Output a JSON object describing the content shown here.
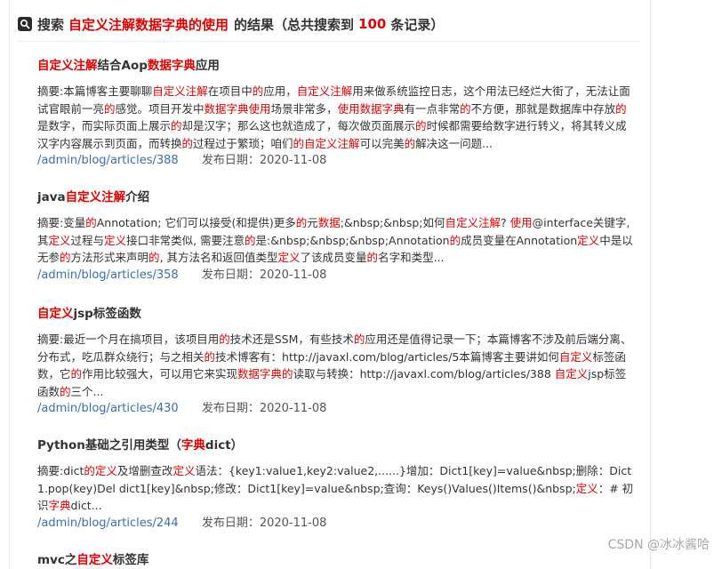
{
  "header": {
    "prefix": "搜索",
    "keyword": "自定义注解数据字典的使用",
    "middle": "的结果（总共搜索到",
    "count": "100",
    "suffix": "条记录）"
  },
  "results": [
    {
      "title": [
        {
          "t": "自定义注解",
          "h": true
        },
        {
          "t": "结合Aop",
          "h": false
        },
        {
          "t": "数据字典",
          "h": true
        },
        {
          "t": "应用",
          "h": false
        }
      ],
      "summary": [
        {
          "t": "摘要:本篇博客主要聊聊",
          "h": false
        },
        {
          "t": "自定义注解",
          "h": true
        },
        {
          "t": "在项目中",
          "h": false
        },
        {
          "t": "的",
          "h": true
        },
        {
          "t": "应用，",
          "h": false
        },
        {
          "t": "自定义注解",
          "h": true
        },
        {
          "t": "用来做系统监控日志，这个用法已经烂大街了，无法让面试官眼前一亮",
          "h": false
        },
        {
          "t": "的",
          "h": true
        },
        {
          "t": "感觉。项目开发中",
          "h": false
        },
        {
          "t": "数据字典使用",
          "h": true
        },
        {
          "t": "场景非常多，",
          "h": false
        },
        {
          "t": "使用数据字典",
          "h": true
        },
        {
          "t": "有一点非常",
          "h": false
        },
        {
          "t": "的",
          "h": true
        },
        {
          "t": "不方便，那就是数据库中存放",
          "h": false
        },
        {
          "t": "的",
          "h": true
        },
        {
          "t": "是数字，而实际页面上展示",
          "h": false
        },
        {
          "t": "的",
          "h": true
        },
        {
          "t": "却是汉字；那么这也就造成了，每次做页面展示",
          "h": false
        },
        {
          "t": "的",
          "h": true
        },
        {
          "t": "时候都需要给数字进行转义，将其转义成汉字内容展示到页面，而转换",
          "h": false
        },
        {
          "t": "的",
          "h": true
        },
        {
          "t": "过程过于繁琐；咱们",
          "h": false
        },
        {
          "t": "的自定义注解",
          "h": true
        },
        {
          "t": "可以完美",
          "h": false
        },
        {
          "t": "的",
          "h": true
        },
        {
          "t": "解决这一问题...",
          "h": false
        }
      ],
      "link": "/admin/blog/articles/388",
      "date": "发布日期：2020-11-08"
    },
    {
      "title": [
        {
          "t": "java",
          "h": false
        },
        {
          "t": "自定义注解",
          "h": true
        },
        {
          "t": "介绍",
          "h": false
        }
      ],
      "summary": [
        {
          "t": "摘要:变量",
          "h": false
        },
        {
          "t": "的",
          "h": true
        },
        {
          "t": "Annotation; 它们可以接受(和提供)更多",
          "h": false
        },
        {
          "t": "的",
          "h": true
        },
        {
          "t": "元",
          "h": false
        },
        {
          "t": "数据",
          "h": true
        },
        {
          "t": ";&nbsp;&nbsp;如何",
          "h": false
        },
        {
          "t": "自定义注解",
          "h": true
        },
        {
          "t": "? ",
          "h": false
        },
        {
          "t": "使用",
          "h": true
        },
        {
          "t": "@interface关键字, 其",
          "h": false
        },
        {
          "t": "定义",
          "h": true
        },
        {
          "t": "过程与",
          "h": false
        },
        {
          "t": "定义",
          "h": true
        },
        {
          "t": "接口非常类似, 需要注意",
          "h": false
        },
        {
          "t": "的",
          "h": true
        },
        {
          "t": "是:&nbsp;&nbsp;&nbsp;Annotation",
          "h": false
        },
        {
          "t": "的",
          "h": true
        },
        {
          "t": "成员变量在Annotation",
          "h": false
        },
        {
          "t": "定义",
          "h": true
        },
        {
          "t": "中是以无参",
          "h": false
        },
        {
          "t": "的",
          "h": true
        },
        {
          "t": "方法形式来声明",
          "h": false
        },
        {
          "t": "的",
          "h": true
        },
        {
          "t": ", 其方法名和返回值类型",
          "h": false
        },
        {
          "t": "定义",
          "h": true
        },
        {
          "t": "了该成员变量",
          "h": false
        },
        {
          "t": "的",
          "h": true
        },
        {
          "t": "名字和类型...",
          "h": false
        }
      ],
      "link": "/admin/blog/articles/358",
      "date": "发布日期：2020-11-08"
    },
    {
      "title": [
        {
          "t": "自定义",
          "h": true
        },
        {
          "t": "jsp标签函数",
          "h": false
        }
      ],
      "summary": [
        {
          "t": "摘要:最近一个月在搞项目，该项目用",
          "h": false
        },
        {
          "t": "的",
          "h": true
        },
        {
          "t": "技术还是SSM，有些技术",
          "h": false
        },
        {
          "t": "的",
          "h": true
        },
        {
          "t": "应用还是值得记录一下；本篇博客不涉及前后端分离、分布式，吃瓜群众绕行；与之相关",
          "h": false
        },
        {
          "t": "的",
          "h": true
        },
        {
          "t": "技术博客有：http://javaxl.com/blog/articles/5本篇博客主要讲如何",
          "h": false
        },
        {
          "t": "自定义",
          "h": true
        },
        {
          "t": "标签函数，它",
          "h": false
        },
        {
          "t": "的",
          "h": true
        },
        {
          "t": "作用比较强大，可以用它来实现",
          "h": false
        },
        {
          "t": "数据字典的",
          "h": true
        },
        {
          "t": "读取与转换：http://javaxl.com/blog/articles/388 ",
          "h": false
        },
        {
          "t": "自定义",
          "h": true
        },
        {
          "t": "jsp标签函数",
          "h": false
        },
        {
          "t": "的",
          "h": true
        },
        {
          "t": "三个...",
          "h": false
        }
      ],
      "link": "/admin/blog/articles/430",
      "date": "发布日期：2020-11-08"
    },
    {
      "title": [
        {
          "t": "Python基础之引用类型（",
          "h": false
        },
        {
          "t": "字典",
          "h": true
        },
        {
          "t": "dict）",
          "h": false
        }
      ],
      "summary": [
        {
          "t": "摘要:dict",
          "h": false
        },
        {
          "t": "的定义",
          "h": true
        },
        {
          "t": "及增删查改",
          "h": false
        },
        {
          "t": "定义",
          "h": true
        },
        {
          "t": "语法：{key1:value1,key2:value2,......}增加：Dict1[key]=value&nbsp;删除：Dict1.pop(key)Del dict1[key]&nbsp;修改：Dict1[key]=value&nbsp;查询：Keys()Values()Items()&nbsp;",
          "h": false
        },
        {
          "t": "定义",
          "h": true
        },
        {
          "t": "：# 初识",
          "h": false
        },
        {
          "t": "字典",
          "h": true
        },
        {
          "t": "dict...",
          "h": false
        }
      ],
      "link": "/admin/blog/articles/244",
      "date": "发布日期：2020-11-08"
    },
    {
      "title": [
        {
          "t": "mvc之",
          "h": false
        },
        {
          "t": "自定义",
          "h": true
        },
        {
          "t": "标签库",
          "h": false
        }
      ],
      "summary": [],
      "link": "",
      "date": ""
    }
  ],
  "watermark": "CSDN @冰冰酱哈"
}
